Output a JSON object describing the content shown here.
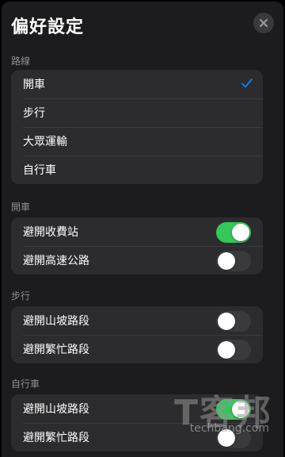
{
  "header": {
    "title": "偏好設定",
    "close_icon": "close-icon"
  },
  "route": {
    "label": "路線",
    "items": [
      {
        "label": "開車",
        "selected": true
      },
      {
        "label": "步行",
        "selected": false
      },
      {
        "label": "大眾運輸",
        "selected": false
      },
      {
        "label": "自行車",
        "selected": false
      }
    ]
  },
  "driving": {
    "label": "開車",
    "items": [
      {
        "label": "避開收費站",
        "on": true
      },
      {
        "label": "避開高速公路",
        "on": false
      }
    ]
  },
  "walking": {
    "label": "步行",
    "items": [
      {
        "label": "避開山坡路段",
        "on": false
      },
      {
        "label": "避開繁忙路段",
        "on": false
      }
    ]
  },
  "cycling": {
    "label": "自行車",
    "items": [
      {
        "label": "避開山坡路段",
        "on": true
      },
      {
        "label": "避開繁忙路段",
        "on": false
      }
    ]
  },
  "colors": {
    "accent": "#0a84ff",
    "toggle_on": "#34c759",
    "background": "#1c1c1e",
    "group": "#2c2c2e"
  },
  "watermark": {
    "main": "T客邦",
    "sub": "techbang.com"
  }
}
